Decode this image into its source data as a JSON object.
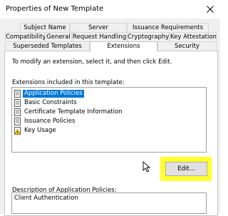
{
  "window": {
    "title": "Properties of New Template"
  },
  "tabs": {
    "row1": [
      "Subject Name",
      "Server",
      "Issuance Requirements"
    ],
    "row2": [
      "Compatibility",
      "General",
      "Request Handling",
      "Cryptography",
      "Key Attestation"
    ],
    "row3": [
      "Superseded Templates",
      "Extensions",
      "Security"
    ],
    "selected": "Extensions"
  },
  "extensions": {
    "instruction": "To modify an extension, select it, and then click Edit.",
    "list_label": "Extensions included in this template:",
    "items": [
      {
        "label": "Application Policies",
        "icon": "extension-page-icon",
        "selected": true
      },
      {
        "label": "Basic Constraints",
        "icon": "extension-page-icon",
        "selected": false
      },
      {
        "label": "Certificate Template Information",
        "icon": "extension-page-icon",
        "selected": false
      },
      {
        "label": "Issuance Policies",
        "icon": "extension-page-icon",
        "selected": false
      },
      {
        "label": "Key Usage",
        "icon": "warning-page-icon",
        "selected": false
      }
    ],
    "edit_button": "Edit...",
    "description_label": "Description of Application Policies:",
    "description_text": "Client Authentication"
  },
  "colors": {
    "selection": "#0078d7",
    "highlight": "#ffff2e",
    "tab_border": "#d9d9d9",
    "dialog_bg": "#f0f0f0"
  }
}
